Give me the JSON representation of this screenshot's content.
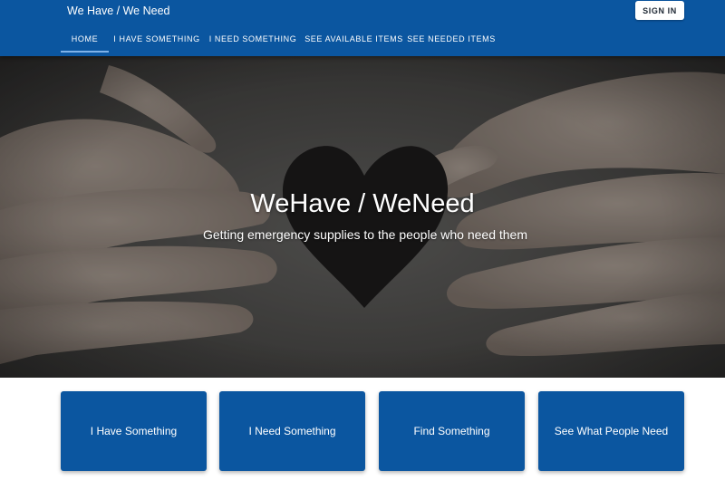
{
  "header": {
    "site_title": "We Have / We Need",
    "signin_label": "SIGN IN",
    "nav": [
      {
        "label": "HOME"
      },
      {
        "label": "I HAVE SOMETHING"
      },
      {
        "label": "I NEED SOMETHING"
      },
      {
        "label": "SEE AVAILABLE ITEMS"
      },
      {
        "label": "SEE NEEDED ITEMS"
      }
    ],
    "active_tab": "HOME"
  },
  "hero": {
    "title": "WeHave / WeNeed",
    "subtitle": "Getting emergency supplies to the people who need them",
    "image": "hands-holding-paper-heart"
  },
  "cards": [
    {
      "label": "I Have Something"
    },
    {
      "label": "I Need Something"
    },
    {
      "label": "Find Something"
    },
    {
      "label": "See What People Need"
    }
  ],
  "colors": {
    "primary": "#0b56a0",
    "tab_indicator": "#7fb2e8",
    "text_on_primary": "#ffffff",
    "page_background": "#ffffff"
  }
}
